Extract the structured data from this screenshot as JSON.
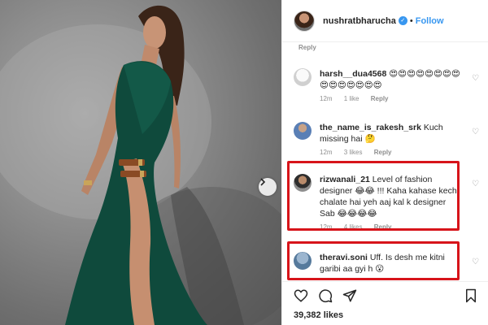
{
  "post_header": {
    "username": "nushratbharucha",
    "separator": "•",
    "follow_label": "Follow"
  },
  "top_meta": {
    "reply_label": "Reply"
  },
  "comments": [
    {
      "username": "harsh__dua4568",
      "text": "😍😍😍😍😍😍😍😍😍😍😍😍😍😍😍",
      "time": "12m",
      "likes": "1 like",
      "reply": "Reply"
    },
    {
      "username": "the_name_is_rakesh_srk",
      "text": "Kuch missing hai 🤔",
      "time": "12m",
      "likes": "3 likes",
      "reply": "Reply"
    },
    {
      "username": "rizwanali_21",
      "text": "Level of fashion designer 😂😂 !!! Kaha kahase kechi chalate hai yeh aaj kal k designer Sab 😂😂😂😂",
      "time": "12m",
      "likes": "4 likes",
      "reply": "Reply"
    },
    {
      "username": "theravi.soni",
      "text": "Uff. Is desh me kitni garibi aa gyi h 😮",
      "time": "",
      "likes": "",
      "reply": ""
    }
  ],
  "likes_count": "39,382 likes",
  "icons": {
    "like": "heart-icon",
    "comment": "comment-icon",
    "share": "share-icon",
    "save": "bookmark-icon",
    "verified": "verified-badge-icon",
    "next": "chevron-right-icon"
  },
  "colors": {
    "accent": "#3897f0",
    "highlight": "#d7141a",
    "dress": "#0f4a3c",
    "meta_text": "#8e8e8e"
  }
}
